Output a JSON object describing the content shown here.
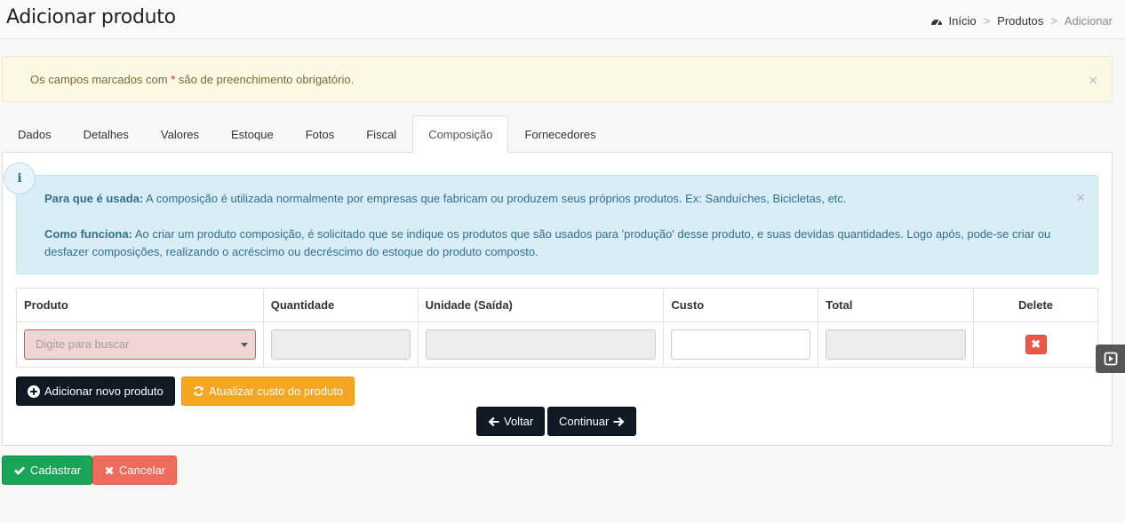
{
  "header": {
    "title": "Adicionar produto",
    "breadcrumb": {
      "home": "Início",
      "section": "Produtos",
      "current": "Adicionar",
      "separator": ">"
    }
  },
  "warning_alert": {
    "text_before": "Os campos marcados com ",
    "asterisk": "*",
    "text_after": " são de preenchimento obrigatório.",
    "close": "×"
  },
  "tabs": [
    {
      "label": "Dados"
    },
    {
      "label": "Detalhes"
    },
    {
      "label": "Valores"
    },
    {
      "label": "Estoque"
    },
    {
      "label": "Fotos"
    },
    {
      "label": "Fiscal"
    },
    {
      "label": "Composição",
      "active": true
    },
    {
      "label": "Fornecedores"
    }
  ],
  "info_alert": {
    "badge": "i",
    "close": "×",
    "para1_title": "Para que é usada:",
    "para1_text": " A composição é utilizada normalmente por empresas que fabricam ou produzem seus próprios produtos. Ex: Sanduíches, Bicicletas, etc.",
    "para2_title": "Como funciona:",
    "para2_text": " Ao criar um produto composição, é solicitado que se indique os produtos que são usados para 'produção' desse produto, e suas devidas quantidades. Logo após, pode-se criar ou desfazer composições, realizando o acréscimo ou decréscimo do estoque do produto composto."
  },
  "table": {
    "columns": [
      "Produto",
      "Quantidade",
      "Unidade (Saída)",
      "Custo",
      "Total",
      "Delete"
    ],
    "row": {
      "produto_placeholder": "Digite para buscar",
      "delete_label": "✖"
    }
  },
  "buttons": {
    "add_product": "Adicionar novo produto",
    "update_cost": "Atualizar custo do produto",
    "back": "Voltar",
    "continue": "Continuar",
    "submit": "Cadastrar",
    "cancel": "Cancelar"
  },
  "colors": {
    "warning_bg": "#fcf8e3",
    "info_bg": "#d9edf7",
    "dark_button": "#111a24",
    "orange_button": "#f5a623",
    "green_button": "#18a558",
    "red_button": "#ef6b5c",
    "error_field": "#f1d4d4"
  }
}
